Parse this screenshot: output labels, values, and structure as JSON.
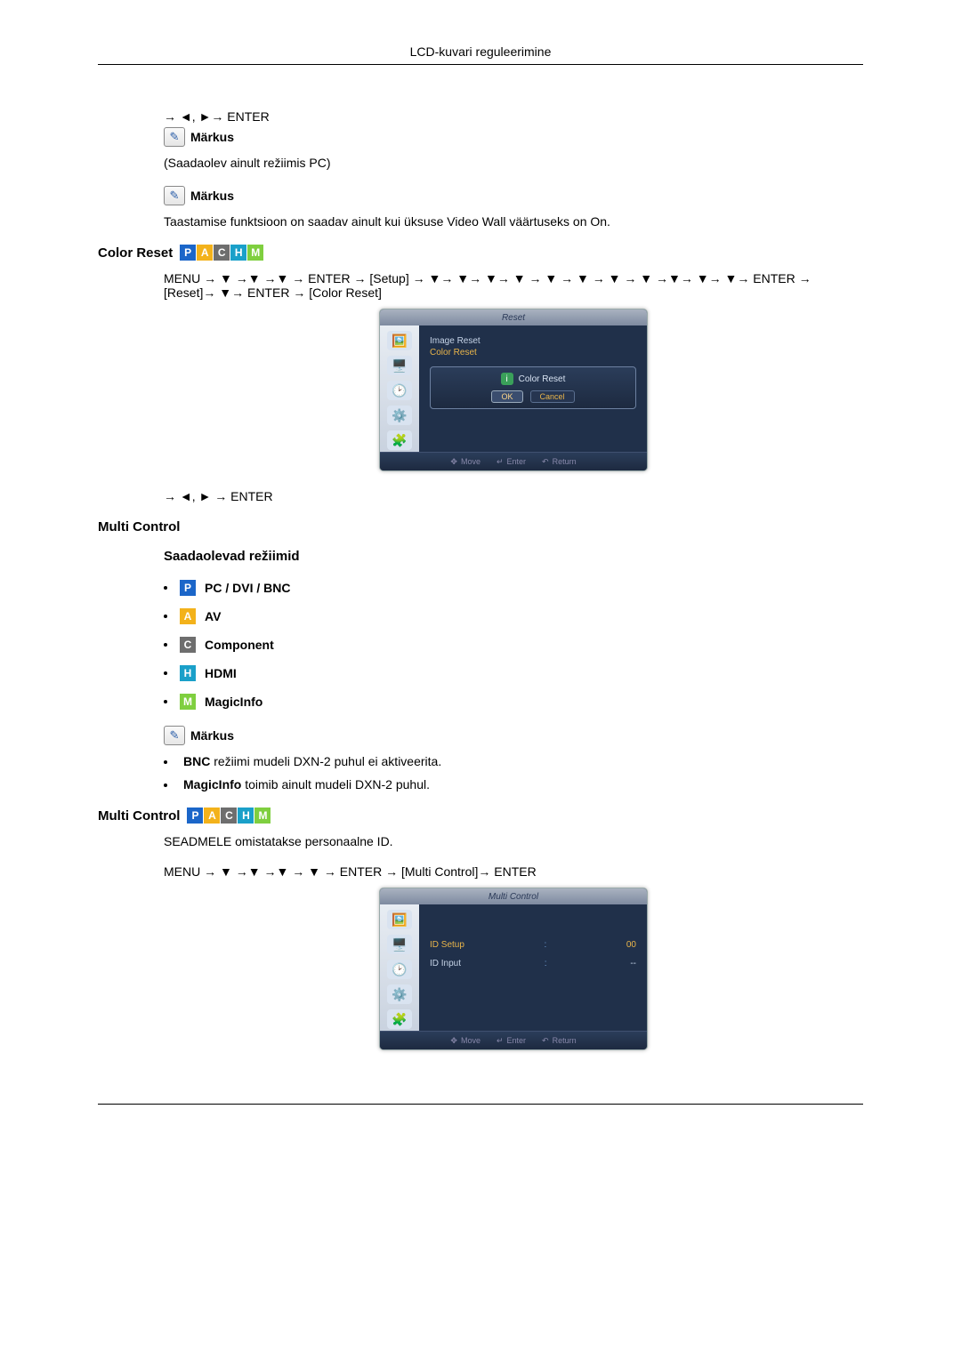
{
  "page_header": "LCD-kuvari reguleerimine",
  "nav": {
    "top_enter": "→ ◄, ►→ ENTER",
    "color_reset_path": "MENU → ▼ →▼ →▼ → ENTER → [Setup] → ▼→ ▼→ ▼→ ▼ → ▼ → ▼ → ▼ → ▼ →▼→ ▼→ ▼→ ENTER → [Reset]→ ▼→ ENTER → [Color Reset]",
    "lr_enter": "→ ◄, ► → ENTER",
    "multi_control_path": "MENU → ▼ →▼ →▼ → ▼ → ENTER → [Multi Control]→ ENTER"
  },
  "notes": {
    "label": "Märkus",
    "note1_text": "(Saadaolev ainult režiimis PC)",
    "note2_text": "Taastamise funktsioon on saadav ainult kui üksuse Video Wall väärtuseks on On.",
    "bnc_note_prefix": "BNC",
    "bnc_note_rest": " režiimi mudeli DXN-2 puhul ei aktiveerita.",
    "magicinfo_note_prefix": "MagicInfo",
    "magicinfo_note_rest": " toimib ainult mudeli DXN-2 puhul."
  },
  "sections": {
    "color_reset": "Color Reset",
    "multi_control": "Multi Control",
    "available_modes": "Saadaolevad režiimid",
    "multi_control_desc": "SEADMELE omistatakse personaalne ID."
  },
  "modes": {
    "pc": "PC / DVI / BNC",
    "av": "AV",
    "component": "Component",
    "hdmi": "HDMI",
    "magicinfo": "MagicInfo"
  },
  "osd_reset": {
    "title": "Reset",
    "image_reset": "Image Reset",
    "color_reset": "Color Reset",
    "dialog_title": "Color Reset",
    "ok": "OK",
    "cancel": "Cancel",
    "move": "Move",
    "enter": "Enter",
    "return": "Return"
  },
  "osd_multi": {
    "title": "Multi Control",
    "id_setup": "ID Setup",
    "id_setup_val": "00",
    "id_input": "ID Input",
    "id_input_val": "--",
    "move": "Move",
    "enter": "Enter",
    "return": "Return"
  }
}
